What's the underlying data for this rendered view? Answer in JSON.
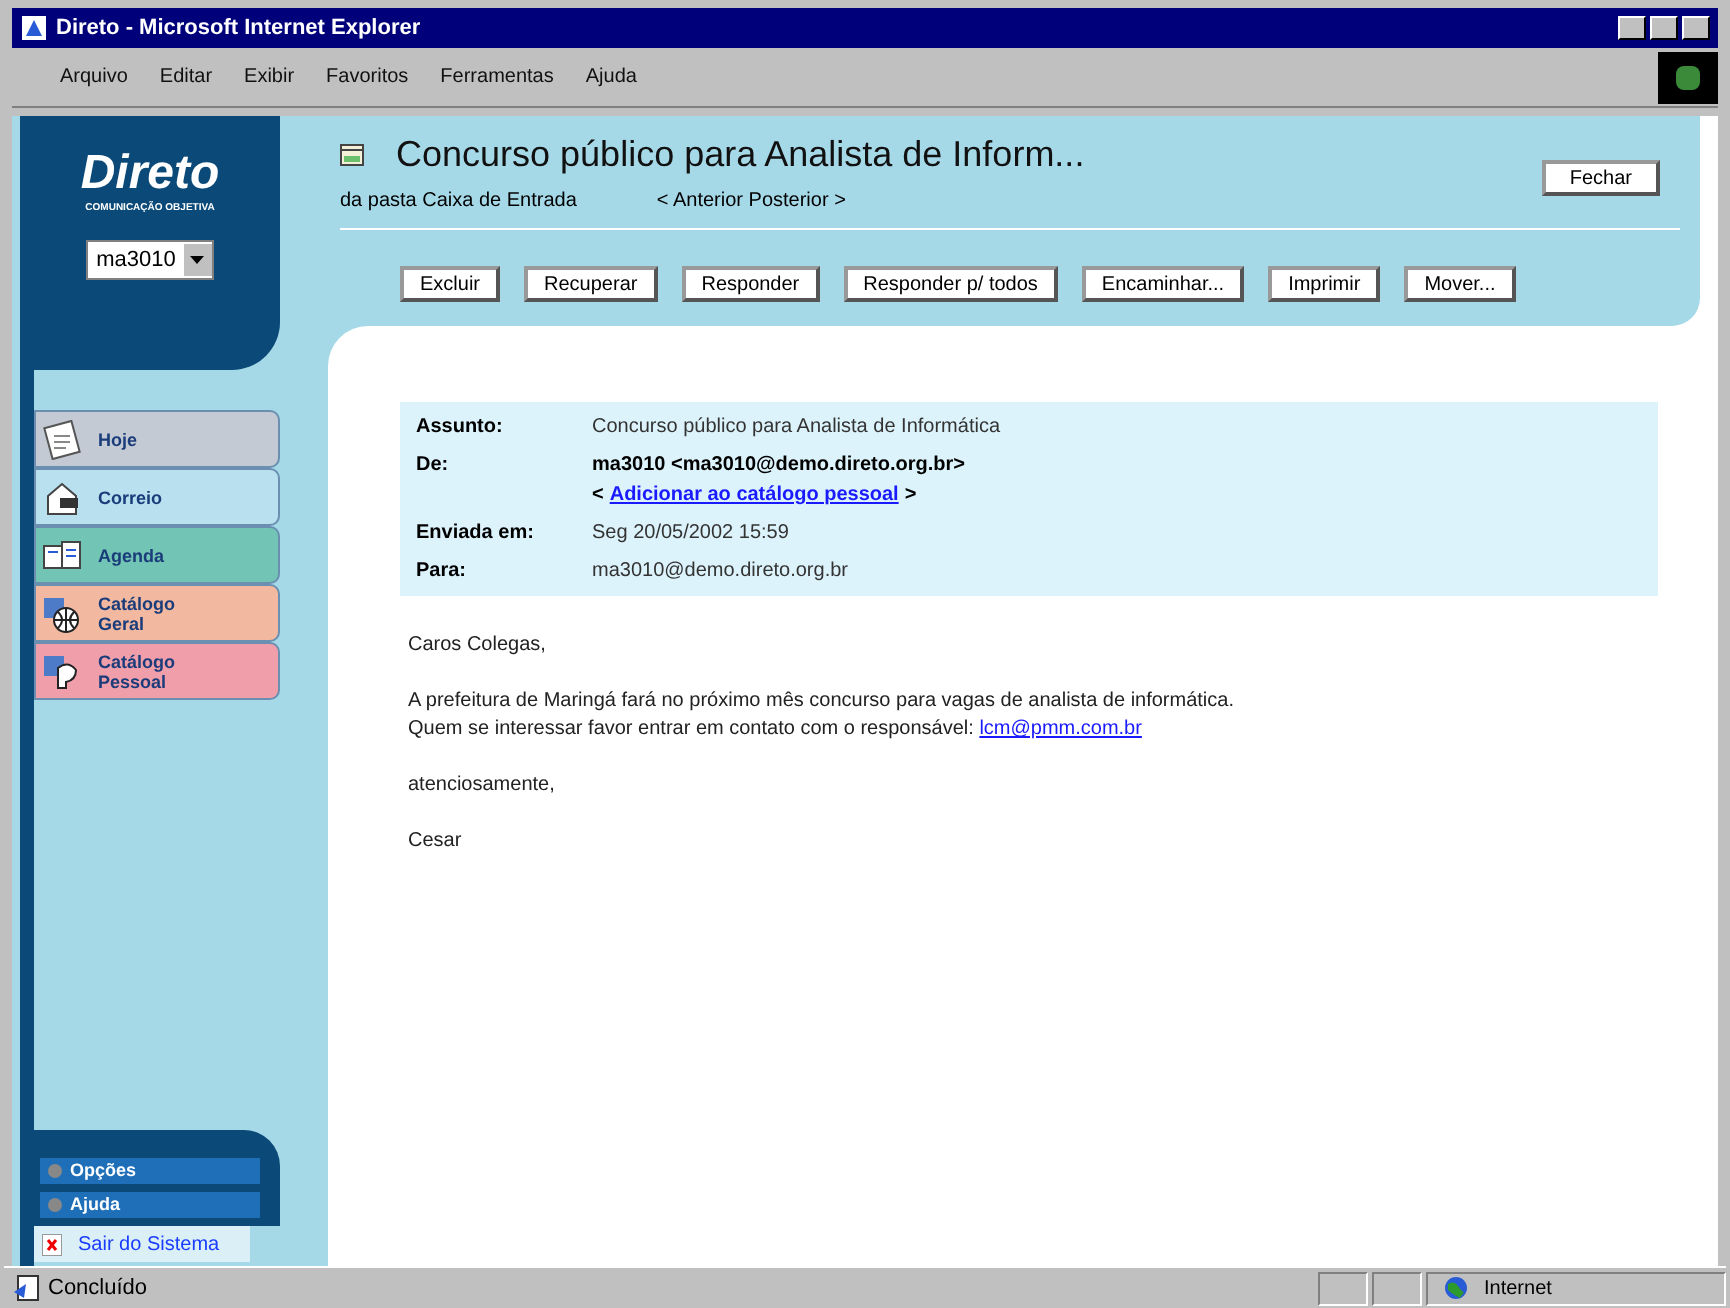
{
  "window": {
    "title": "Direto - Microsoft Internet Explorer"
  },
  "menu": [
    "Arquivo",
    "Editar",
    "Exibir",
    "Favoritos",
    "Ferramentas",
    "Ajuda"
  ],
  "sidebar": {
    "logo": "Direto",
    "tagline": "COMUNICAÇÃO OBJETIVA",
    "user": "ma3010",
    "nav": [
      {
        "label": "Hoje",
        "color": "#c4cad4",
        "kind": "calendar"
      },
      {
        "label": "Correio",
        "color": "#b9e0ee",
        "kind": "mail"
      },
      {
        "label": "Agenda",
        "color": "#72c4b4",
        "kind": "planner"
      },
      {
        "label": "Catálogo Geral",
        "color": "#f2b9a0",
        "kind": "globe"
      },
      {
        "label": "Catálogo Pessoal",
        "color": "#f09eaa",
        "kind": "person"
      }
    ],
    "bottom": [
      "Opções",
      "Ajuda"
    ],
    "logout": "Sair do Sistema"
  },
  "header": {
    "subject": "Concurso público para Analista de Inform...",
    "folder": "da pasta Caixa de Entrada",
    "pager": "< Anterior Posterior >",
    "close": "Fechar",
    "buttons": [
      "Excluir",
      "Recuperar",
      "Responder",
      "Responder p/ todos",
      "Encaminhar...",
      "Imprimir",
      "Mover..."
    ]
  },
  "message": {
    "fields": [
      {
        "label": "Assunto:",
        "value": "Concurso público para Analista de Informática"
      },
      {
        "label": "De:",
        "value": "ma3010 <ma3010@demo.direto.org.br>",
        "link_prefix": "<",
        "link": "Adicionar ao catálogo pessoal",
        "link_suffix": ">"
      },
      {
        "label": "Enviada em:",
        "value": "Seg 20/05/2002 15:59"
      },
      {
        "label": "Para:",
        "value": "ma3010@demo.direto.org.br"
      }
    ],
    "body": [
      {
        "lines": [
          "Caros Colegas,"
        ]
      },
      {
        "lines": [
          "A prefeitura de Maringá fará no próximo mês concurso para vagas de analista de informática.",
          "Quem se interessar favor entrar em contato com o responsável: "
        ],
        "link": "lcm@pmm.com.br"
      },
      {
        "lines": [
          "atenciosamente,"
        ]
      },
      {
        "lines": [
          "Cesar"
        ]
      }
    ]
  },
  "status_bar": {
    "text": "Concluído",
    "zone": "Internet"
  }
}
